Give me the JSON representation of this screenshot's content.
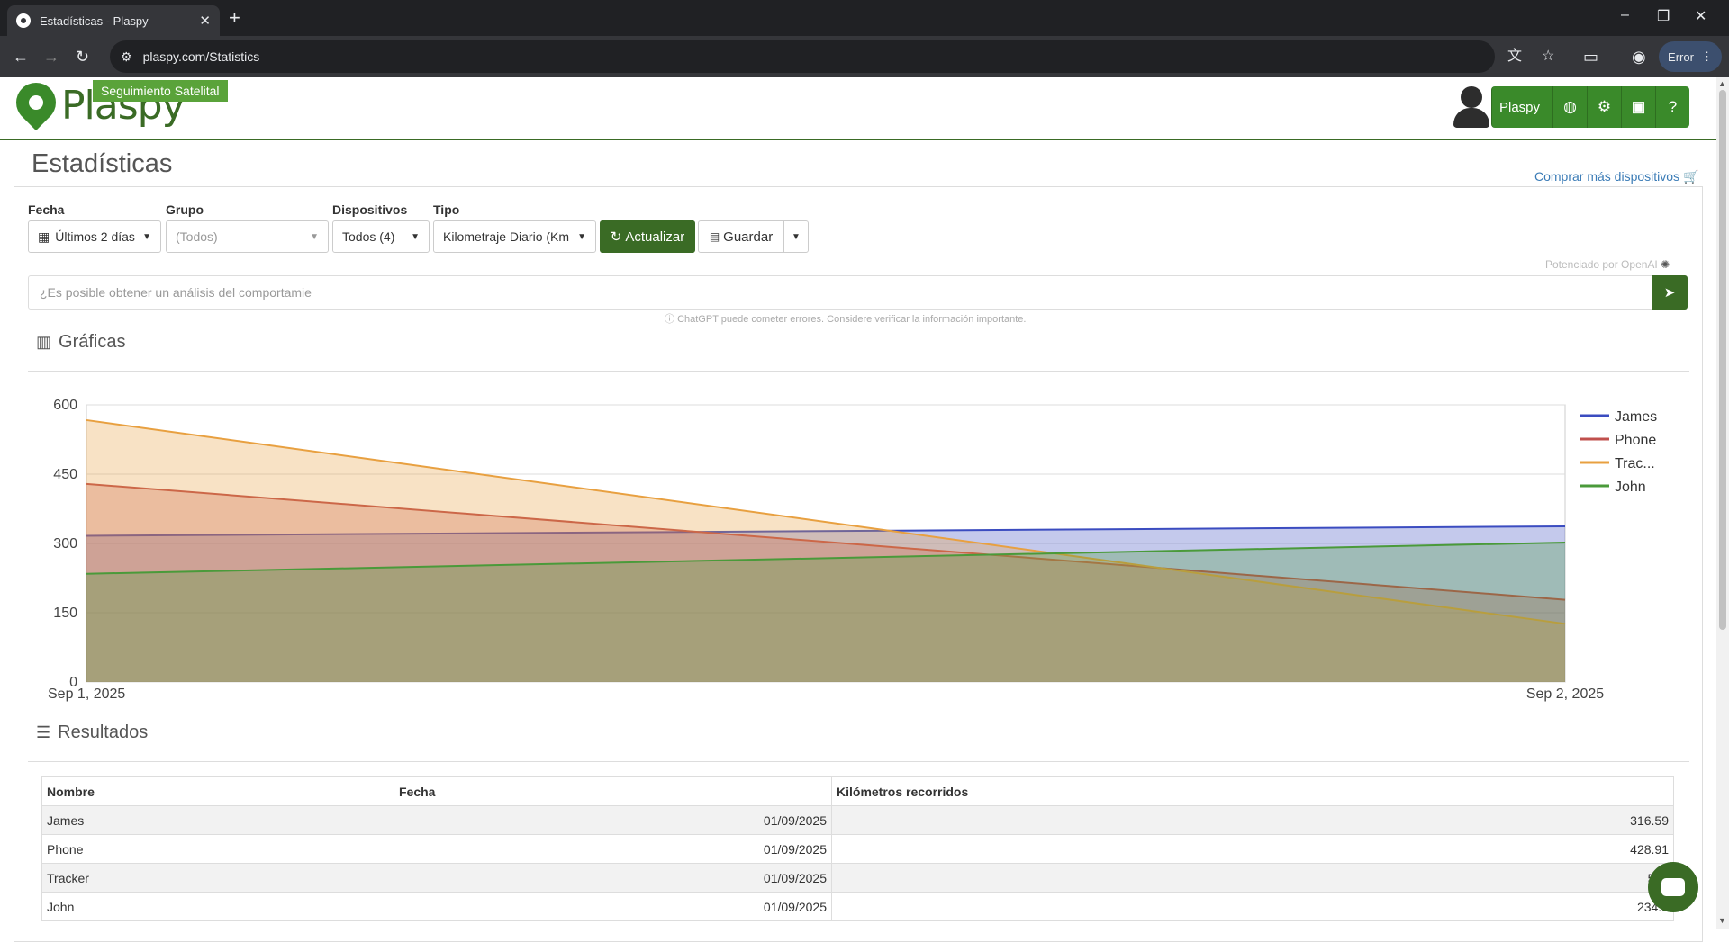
{
  "browser": {
    "tab_title": "Estadísticas - Plaspy",
    "url": "plaspy.com/Statistics",
    "profile_status": "Error",
    "icons": [
      "back-icon",
      "forward-icon",
      "reload-icon",
      "site-settings-icon",
      "translate-icon",
      "star-icon",
      "cast-icon",
      "account-icon",
      "menu-icon"
    ]
  },
  "header": {
    "logo_text": "Plaspy",
    "badge": "Seguimiento Satelital",
    "user_name": "Plaspy",
    "accent_color": "#3a8a2a"
  },
  "page": {
    "title": "Estadísticas",
    "buy_link": "Comprar más dispositivos"
  },
  "filters": {
    "fecha_label": "Fecha",
    "fecha_value": "Últimos 2 días",
    "grupo_label": "Grupo",
    "grupo_value": "(Todos)",
    "dispositivos_label": "Dispositivos",
    "dispositivos_value": "Todos (4)",
    "tipo_label": "Tipo",
    "tipo_value": "Kilometraje Diario (Km",
    "refresh_label": "Actualizar",
    "save_label": "Guardar"
  },
  "ai": {
    "powered_by": "Potenciado por OpenAI",
    "placeholder": "¿Es posible obtener un análisis del comportamie",
    "note": "ChatGPT puede cometer errores. Considere verificar la información importante."
  },
  "sections": {
    "charts": "Gráficas",
    "results": "Resultados"
  },
  "chart_data": {
    "type": "area",
    "x": [
      "Sep 1, 2025",
      "Sep 2, 2025"
    ],
    "ylim": [
      0,
      600
    ],
    "yticks": [
      0,
      150,
      300,
      450,
      600
    ],
    "grid": true,
    "legend_position": "right",
    "series": [
      {
        "name": "James",
        "values": [
          316.59,
          337
        ],
        "color": "#3b4cc0"
      },
      {
        "name": "Phone",
        "values": [
          428.91,
          178
        ],
        "color": "#c0504d"
      },
      {
        "name": "Trac...",
        "values": [
          567,
          126
        ],
        "color": "#e8a040"
      },
      {
        "name": "John",
        "values": [
          234.3,
          302
        ],
        "color": "#4a9a3a"
      }
    ]
  },
  "table": {
    "headers": [
      "Nombre",
      "Fecha",
      "Kilómetros recorridos"
    ],
    "rows": [
      {
        "name": "James",
        "date": "01/09/2025",
        "km": "316.59"
      },
      {
        "name": "Phone",
        "date": "01/09/2025",
        "km": "428.91"
      },
      {
        "name": "Tracker",
        "date": "01/09/2025",
        "km": "567"
      },
      {
        "name": "John",
        "date": "01/09/2025",
        "km": "234.3"
      }
    ]
  }
}
